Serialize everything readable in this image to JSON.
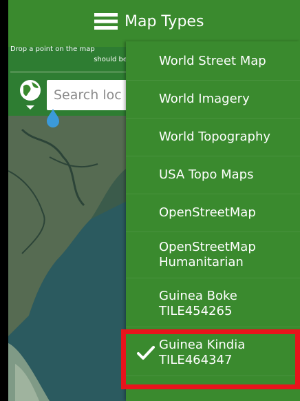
{
  "header": {
    "title": "Map Types"
  },
  "description": {
    "line1": "Drop a point on the map",
    "line2": "should be"
  },
  "search": {
    "placeholder": "Search loc"
  },
  "menu": {
    "items": [
      {
        "label": "World Street Map",
        "selected": false
      },
      {
        "label": "World Imagery",
        "selected": false
      },
      {
        "label": "World Topography",
        "selected": false
      },
      {
        "label": "USA Topo Maps",
        "selected": false
      },
      {
        "label": "OpenStreetMap",
        "selected": false
      },
      {
        "label": "OpenStreetMap Humanitarian",
        "selected": false
      },
      {
        "label": "Guinea Boke TILE454265",
        "selected": false
      },
      {
        "label": "Guinea Kindia TILE464347",
        "selected": true
      }
    ],
    "lines": {
      "i5": [
        "OpenStreetMap",
        "Humanitarian"
      ],
      "i6": [
        "Guinea Boke",
        "TILE454265"
      ],
      "i7": [
        "Guinea Kindia",
        "TILE464347"
      ]
    }
  },
  "colors": {
    "header_bg": "#3a8a2e",
    "menu_bg": "#3a8a2e",
    "highlight": "#e8141c",
    "pin": "#3b9ad9"
  },
  "icons": {
    "menu": "hamburger-icon",
    "globe": "globe-icon",
    "pin": "drop-pin-icon",
    "check": "checkmark-icon"
  }
}
